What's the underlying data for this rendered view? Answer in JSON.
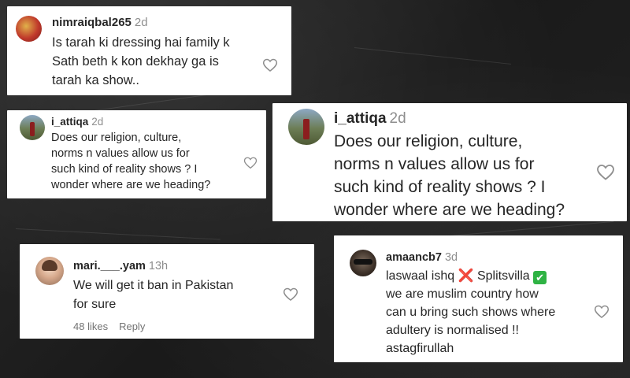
{
  "comments": [
    {
      "username": "nimraiqbal265",
      "age": "2d",
      "lines": [
        "Is tarah ki dressing hai family k",
        "Sath beth k kon dekhay ga is",
        "tarah ka show.."
      ]
    },
    {
      "username": "i_attiqa",
      "age": "2d",
      "lines": [
        "Does our religion, culture,",
        "norms n values allow us for",
        "such kind of reality shows ? I",
        "wonder where are we heading?"
      ]
    },
    {
      "username": "i_attiqa",
      "age": "2d",
      "lines": [
        "Does our religion, culture,",
        "norms n values allow us for",
        "such kind of reality shows ? I",
        "wonder where are we heading?"
      ]
    },
    {
      "username": "mari.___.yam",
      "age": "13h",
      "lines": [
        "We will get it ban in Pakistan",
        "for sure"
      ],
      "likes": "48 likes",
      "reply": "Reply"
    },
    {
      "username": "amaancb7",
      "age": "3d",
      "line1_a": "laswaal ishq",
      "line1_emoji_x": "❌",
      "line1_b": "Splitsvilla",
      "line1_emoji_check": "✔",
      "lines": [
        "we are muslim country how",
        "can u bring such shows where",
        "adultery is normalised !!",
        "astagfirullah"
      ]
    }
  ],
  "icons": {
    "like": "heart-outline-icon"
  },
  "colors": {
    "text": "#262626",
    "muted": "#8e8e8e",
    "card": "#ffffff",
    "x": "#d93025",
    "check": "#2fb344"
  }
}
